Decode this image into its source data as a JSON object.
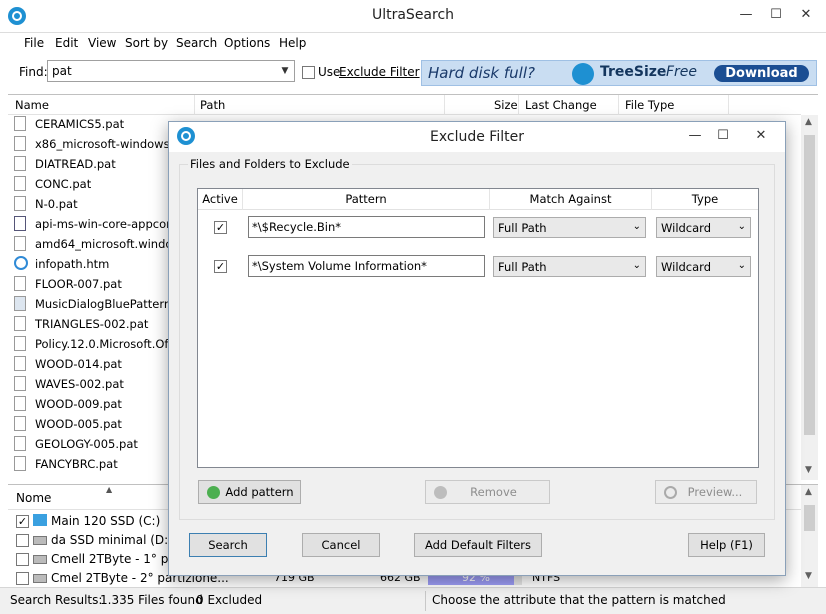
{
  "window": {
    "title": "UltraSearch",
    "min_glyph": "—",
    "max_glyph": "☐",
    "close_glyph": "✕"
  },
  "menu": [
    "File",
    "Edit",
    "View",
    "Sort by",
    "Search",
    "Options",
    "Help"
  ],
  "toolbar": {
    "find_label": "Find:",
    "find_value": "pat",
    "use_label": "Use",
    "exclude_filter_link": "Exclude Filter"
  },
  "ad": {
    "question": "Hard disk full?",
    "product": "TreeSize",
    "edition": "Free",
    "download": "Download"
  },
  "results": {
    "columns": [
      "Name",
      "Path",
      "Size",
      "Last Change",
      "File Type"
    ],
    "files": [
      "CERAMICS5.pat",
      "x86_microsoft-windows-w...",
      "DIATREAD.pat",
      "CONC.pat",
      "N-0.pat",
      "api-ms-win-core-appcompat...",
      "amd64_microsoft.windows.s...",
      "infopath.htm",
      "FLOOR-007.pat",
      "MusicDialogBluePattern.png",
      "TRIANGLES-002.pat",
      "Policy.12.0.Microsoft.Office...",
      "WOOD-014.pat",
      "WAVES-002.pat",
      "WOOD-009.pat",
      "WOOD-005.pat",
      "GEOLOGY-005.pat",
      "FANCYBRC.pat"
    ]
  },
  "drives": {
    "column_name": "Nome",
    "items": [
      {
        "label": "Main 120 SSD (C:)",
        "checked": true
      },
      {
        "label": "da SSD minimal (D:)",
        "checked": false
      },
      {
        "label": "Cmell 2TByte - 1° part",
        "checked": false
      },
      {
        "label": "Cmel 2TByte - 2° partizione...",
        "checked": false
      }
    ],
    "last_row_size": "719 GB",
    "last_row_free": "662 GB",
    "last_row_percent": "92 %",
    "last_row_percent_value": 92,
    "last_row_fs": "NTFS"
  },
  "status": {
    "results": "Search Results:",
    "files_found": "1.335 Files found",
    "excluded": "0 Excluded",
    "hint": "Choose the attribute that the pattern is matched"
  },
  "dialog": {
    "title": "Exclude Filter",
    "group_label": "Files and Folders to Exclude",
    "columns": [
      "Active",
      "Pattern",
      "Match Against",
      "Type"
    ],
    "rows": [
      {
        "active": true,
        "pattern": "*\\$Recycle.Bin*",
        "match": "Full Path",
        "type": "Wildcard"
      },
      {
        "active": true,
        "pattern": "*\\System Volume Information*",
        "match": "Full Path",
        "type": "Wildcard"
      }
    ],
    "add_pattern": "Add pattern",
    "remove": "Remove",
    "preview": "Preview...",
    "search": "Search",
    "cancel": "Cancel",
    "add_default": "Add Default Filters",
    "help": "Help (F1)"
  },
  "colors": {
    "accent": "#1e90d2",
    "ad_bg": "#c9ddf2",
    "download_bg": "#1b4e93",
    "progress": "#9c9cf5"
  }
}
